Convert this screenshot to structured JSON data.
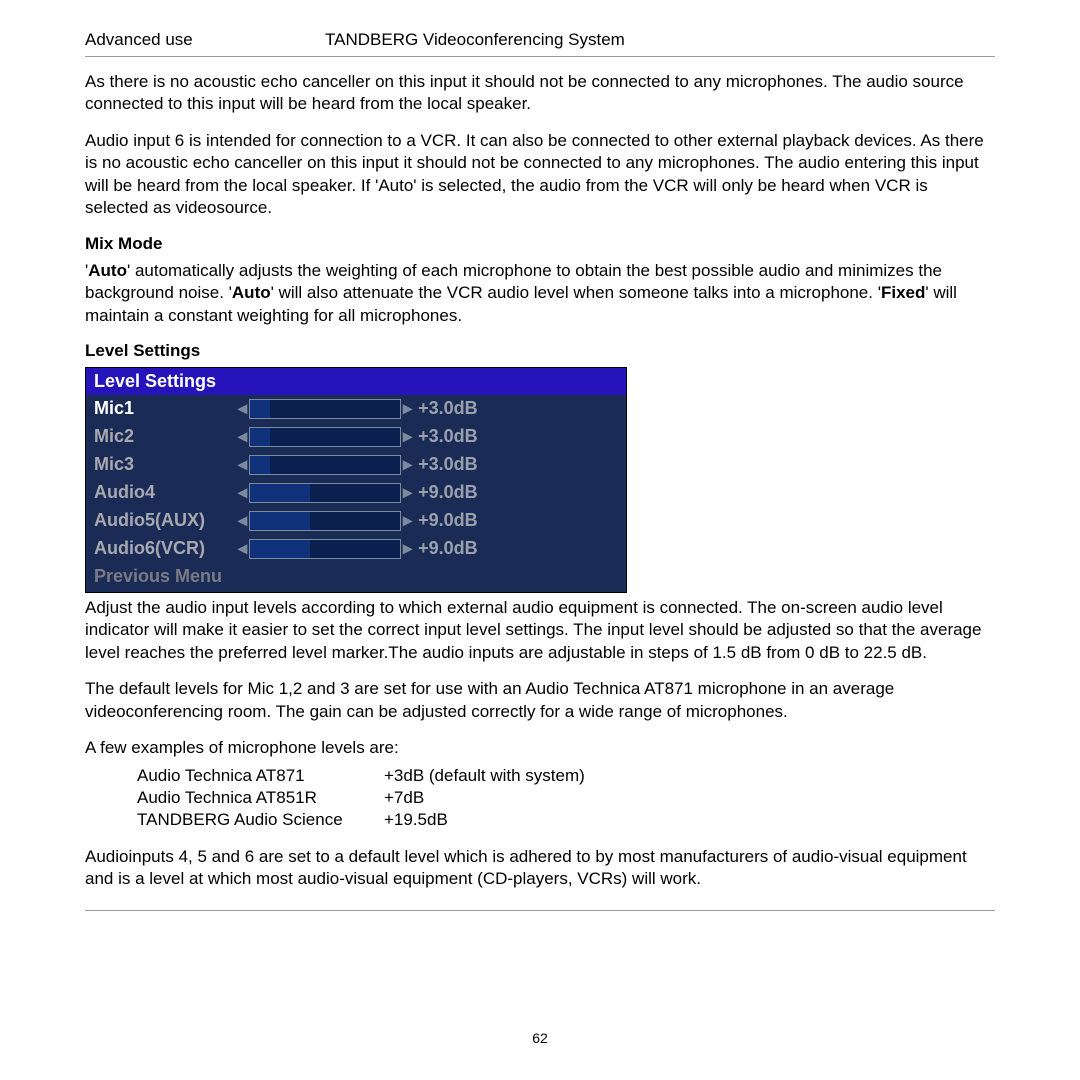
{
  "header": {
    "left": "Advanced use",
    "right": "TANDBERG Videoconferencing System"
  },
  "paragraphs": {
    "p1": "As there is no acoustic echo canceller on this input it should not be connected to any microphones. The audio source connected to this input will be heard from the local speaker.",
    "p2": "Audio input 6 is intended for connection to a VCR. It can also be connected to other external playback devices. As there is no acoustic echo canceller on this input it should not be connected to any microphones. The audio entering this input will be heard from the local speaker. If 'Auto' is selected, the audio from the VCR will only be heard when VCR is selected as videosource.",
    "mixModeTitle": "Mix Mode",
    "mix1a": "'",
    "mix1b": "Auto",
    "mix1c": "' automatically adjusts the weighting of each microphone to obtain the best possible audio and minimizes the background noise. '",
    "mix1d": "Auto",
    "mix1e": "' will also attenuate the VCR audio level when someone talks into a microphone. '",
    "mix1f": "Fixed",
    "mix1g": "' will maintain a constant weighting for all microphones.",
    "levelSettingsTitle": "Level Settings",
    "p3": "Adjust the audio input levels according to which external audio equipment is connected. The on-screen audio level indicator will make it easier to set the correct input level settings. The input level should be adjusted so that the average level reaches the preferred level marker.The audio inputs are adjustable in steps of 1.5 dB from 0 dB to 22.5 dB.",
    "p4": "The default levels for Mic 1,2 and 3 are set for use with an Audio Technica AT871 microphone in an average videoconferencing room. The gain can be adjusted correctly for a wide range of microphones.",
    "p5": "A few examples of microphone levels are:",
    "p6": "Audioinputs 4, 5 and 6 are set to a default level which is adhered to by most manufacturers of  audio-visual equipment and is a level at which most audio-visual equipment (CD-players, VCRs) will work."
  },
  "panel": {
    "title": "Level Settings",
    "rows": [
      {
        "label": "Mic1",
        "value": "+3.0dB",
        "fill": 13,
        "active": true
      },
      {
        "label": "Mic2",
        "value": "+3.0dB",
        "fill": 13,
        "active": false
      },
      {
        "label": "Mic3",
        "value": "+3.0dB",
        "fill": 13,
        "active": false
      },
      {
        "label": "Audio4",
        "value": "+9.0dB",
        "fill": 40,
        "active": false
      },
      {
        "label": "Audio5(AUX)",
        "value": "+9.0dB",
        "fill": 40,
        "active": false
      },
      {
        "label": "Audio6(VCR)",
        "value": "+9.0dB",
        "fill": 40,
        "active": false
      }
    ],
    "previous": "Previous Menu"
  },
  "micExamples": [
    {
      "name": "Audio Technica AT871",
      "level": "+3dB (default with system)"
    },
    {
      "name": "Audio Technica AT851R",
      "level": "+7dB"
    },
    {
      "name": "TANDBERG Audio Science",
      "level": "+19.5dB"
    }
  ],
  "footer": {
    "page": "62"
  }
}
